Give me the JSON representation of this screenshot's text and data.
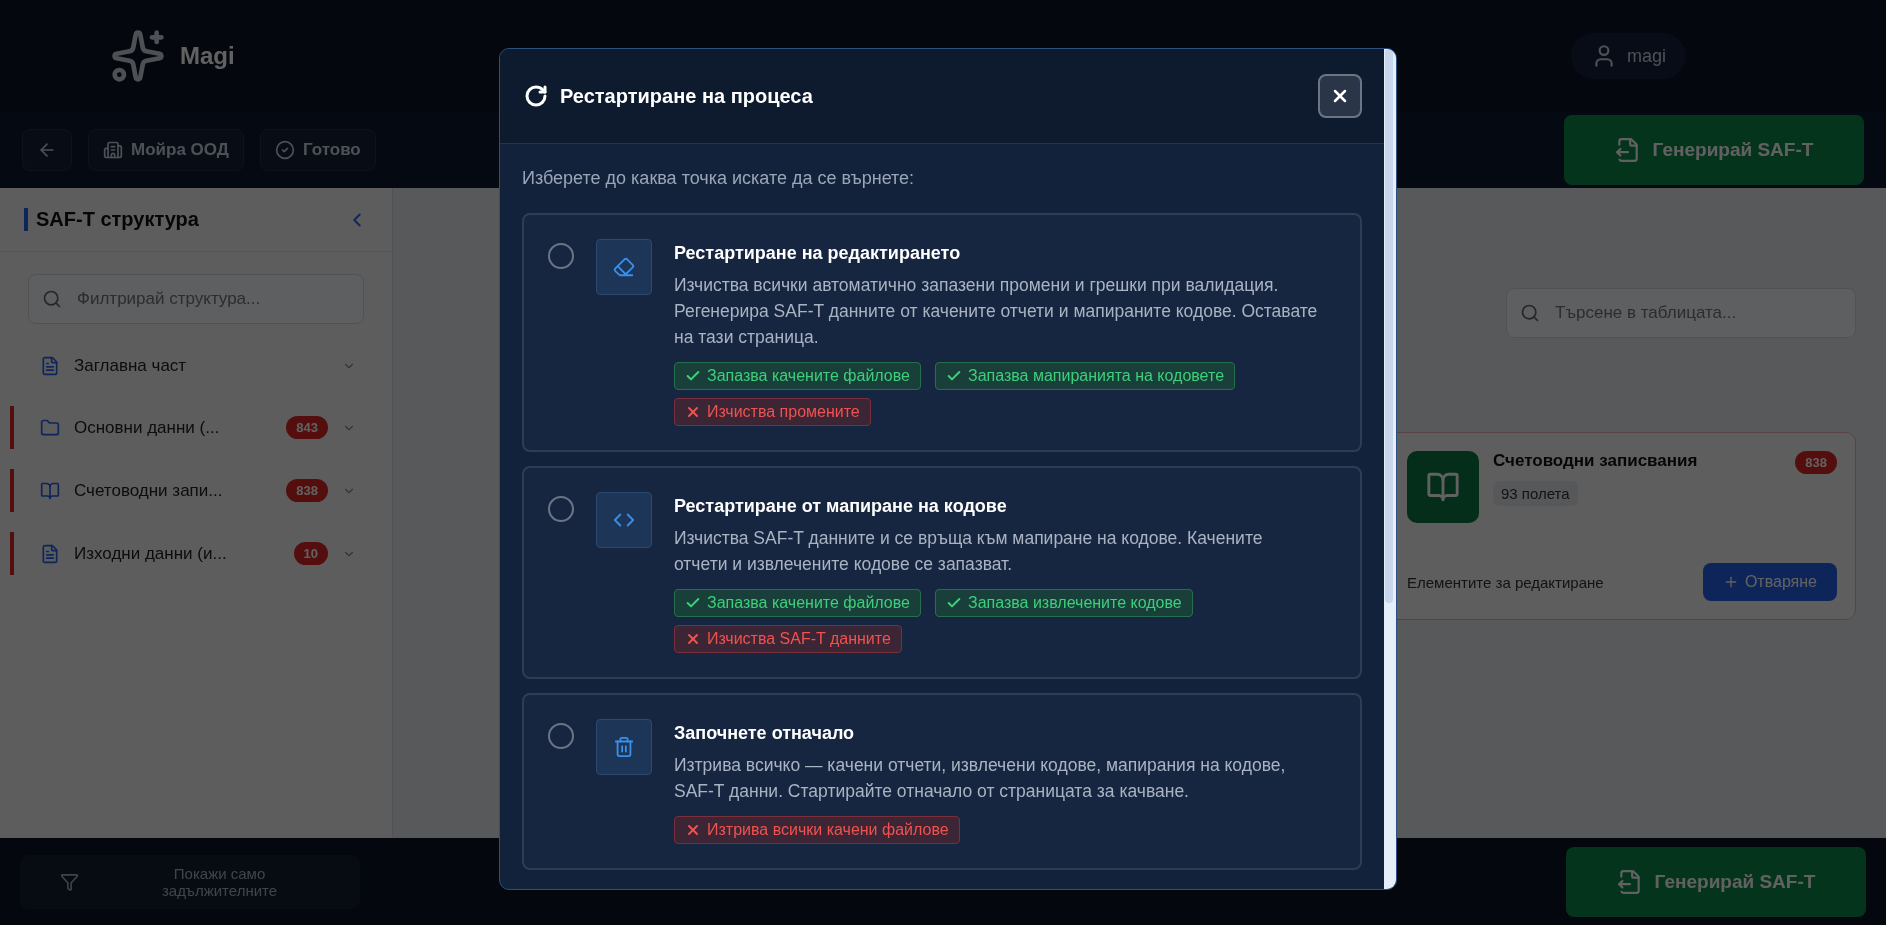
{
  "header": {
    "logo_text": "Magi",
    "user": "magi"
  },
  "toolbar": {
    "company": "Мойра ООД",
    "status": "Готово",
    "generate_button": "Генерирай SAF-T"
  },
  "sidebar": {
    "title": "SAF-T структура",
    "filter_placeholder": "Филтрирай структура...",
    "items": [
      {
        "label": "Заглавна част",
        "has_errors": false
      },
      {
        "label": "Основни данни (...",
        "badge": "843",
        "has_errors": true
      },
      {
        "label": "Счетоводни запи...",
        "badge": "838",
        "has_errors": true
      },
      {
        "label": "Изходни данни (и...",
        "badge": "10",
        "has_errors": true
      }
    ]
  },
  "content": {
    "table_search_placeholder": "Търсене в таблицата...",
    "card": {
      "title": "Счетоводни записвания",
      "badge": "838",
      "fields": "93 полета",
      "footer": "Елементите за редактиране",
      "open_button": "Отваряне"
    }
  },
  "bottom_bar": {
    "required_button": "Покажи само задължителните",
    "generate_button": "Генерирай SAF-T"
  },
  "dialog": {
    "title": "Рестартиране на процеса",
    "prompt": "Изберете до каква точка искате да се върнете:",
    "options": [
      {
        "title": "Рестартиране на редактирането",
        "description": "Изчиства всички автоматично запазени промени и грешки при валидация. Регенерира SAF-T данните от качените отчети и мапираните кодове. Оставате на тази страница.",
        "selected": false,
        "tags": [
          {
            "kind": "keep",
            "text": "Запазва качените файлове"
          },
          {
            "kind": "keep",
            "text": "Запазва мапиранията на кодовете"
          },
          {
            "kind": "clear",
            "text": "Изчиства промените"
          }
        ]
      },
      {
        "title": "Рестартиране от мапиране на кодове",
        "description": "Изчиства SAF-T данните и се връща към мапиране на кодове. Качените отчети и извлечените кодове се запазват.",
        "selected": false,
        "tags": [
          {
            "kind": "keep",
            "text": "Запазва качените файлове"
          },
          {
            "kind": "keep",
            "text": "Запазва извлечените кодове"
          },
          {
            "kind": "clear",
            "text": "Изчиства SAF-T данните"
          }
        ]
      },
      {
        "title": "Започнете отначало",
        "description": "Изтрива всичко — качени отчети, извлечени кодове, мапирания на кодове, SAF-T данни. Стартирайте отначало от страницата за качване.",
        "selected": false,
        "tags": [
          {
            "kind": "clear",
            "text": "Изтрива всички качени файлове"
          }
        ]
      }
    ]
  }
}
